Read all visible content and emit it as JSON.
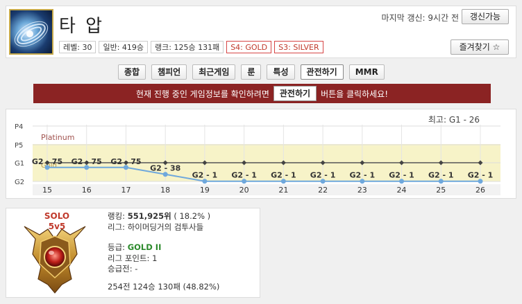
{
  "summoner": {
    "name": "타 압",
    "last_update": "마지막 갱신: 9시간 전",
    "refresh_label": "갱신가능",
    "favorite_label": "즐겨찾기 ☆",
    "badges": [
      "레벨: 30",
      "일반: 419승",
      "랭크: 125승 131패",
      "S4: GOLD",
      "S3: SILVER"
    ]
  },
  "tabs": [
    "종합",
    "챔피언",
    "최근게임",
    "룬",
    "특성",
    "관전하기",
    "MMR"
  ],
  "active_tab": "관전하기",
  "banner": {
    "prefix": "현재 진행 중인 게임정보를 확인하려면",
    "button": "관전하기",
    "suffix": "버튼을 클릭하세요!"
  },
  "chart_data": {
    "type": "line",
    "title": "최고: G1 - 26",
    "y_ticks": [
      "P4",
      "P5",
      "G1",
      "G2"
    ],
    "bands": [
      "Platinum",
      "Gold"
    ],
    "x": [
      15,
      16,
      17,
      18,
      19,
      20,
      21,
      22,
      23,
      24,
      25,
      26
    ],
    "series": [
      {
        "values": [
          "G1",
          "G1",
          "G1",
          "G1",
          "G1",
          "G1",
          "G1",
          "G1",
          "G1",
          "G1",
          "G1",
          "G1"
        ],
        "color": "#555555"
      },
      {
        "values": [
          "G2 - 75",
          "G2 - 75",
          "G2 - 75",
          "G2 - 38",
          "G2 - 1",
          "G2 - 1",
          "G2 - 1",
          "G2 - 1",
          "G2 - 1",
          "G2 - 1",
          "G2 - 1",
          "G2 - 1"
        ],
        "lp": [
          75,
          75,
          75,
          38,
          1,
          1,
          1,
          1,
          1,
          1,
          1,
          1
        ],
        "color": "#6fa8dc"
      }
    ],
    "grid": true
  },
  "rank": {
    "queue": [
      "SOLO",
      "5v5"
    ],
    "ranking_label": "랭킹:",
    "ranking_value": "551,925위",
    "ranking_pct": "( 18.2% )",
    "league": "리그: 하이머딩거의 검투사들",
    "tier_label": "등급:",
    "tier_value": "GOLD II",
    "league_points": "리그 포인트: 1",
    "promotion": "승급전: -",
    "record": "254전 124승 130패 (48.82%)"
  },
  "colors": {
    "banner": "#8b2323",
    "accent_red": "#c0392b",
    "gold_band": "#f7f3c8",
    "line_blue": "#6fa8dc"
  }
}
